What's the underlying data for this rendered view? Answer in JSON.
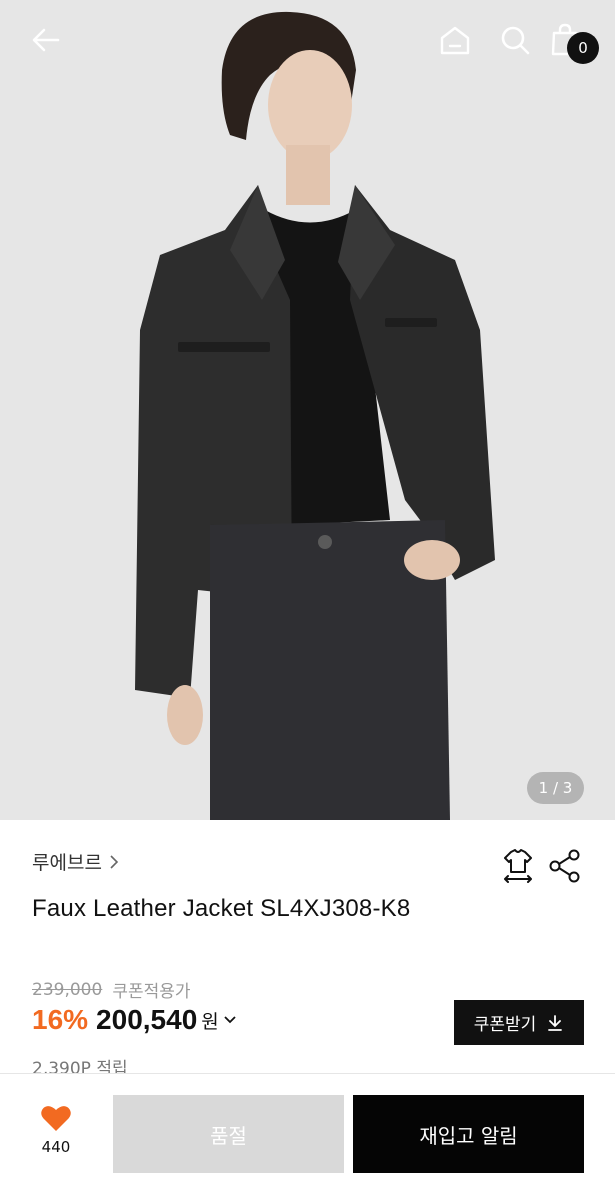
{
  "header": {
    "cart_count": "0",
    "icons": [
      "back-arrow-icon",
      "home-icon",
      "search-icon",
      "shopping-bag-icon"
    ]
  },
  "gallery": {
    "pager": "1 / 3"
  },
  "product": {
    "brand": "루에브르",
    "title": "Faux Leather Jacket SL4XJ308-K8",
    "original_price": "239,000",
    "coupon_price_label": "쿠폰적용가",
    "discount": "16%",
    "price": "200,540",
    "currency": "원",
    "points": "2,390P 적립"
  },
  "actions": {
    "coupon_button": "쿠폰받기",
    "like_count": "440",
    "soldout_button": "품절",
    "restock_button": "재입고 알림"
  },
  "colors": {
    "discount": "#f26a21",
    "like_heart": "#f26a21",
    "primary_button": "#050505",
    "disabled_button": "#d9d9d9"
  }
}
